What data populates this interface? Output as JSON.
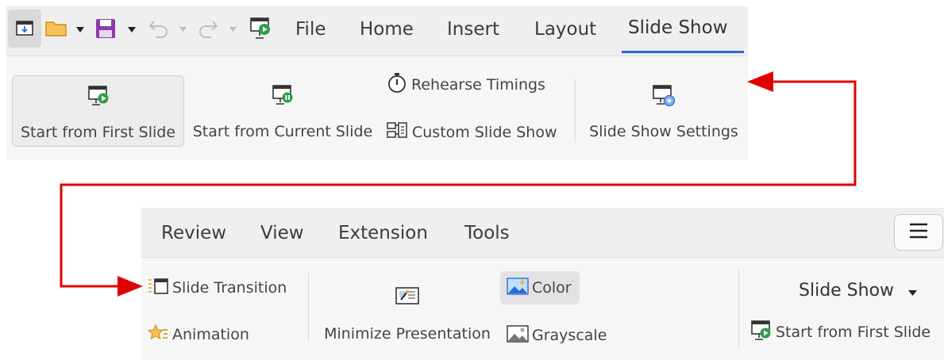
{
  "toolbar1": {
    "quick_access": [
      "slide-icon",
      "open-folder-icon",
      "save-icon",
      "undo-icon",
      "redo-icon",
      "play-slideshow-icon"
    ],
    "tabs": [
      "File",
      "Home",
      "Insert",
      "Layout",
      "Slide Show"
    ],
    "active_tab": "Slide Show",
    "start_first": "Start from First Slide",
    "start_current": "Start from Current Slide",
    "rehearse": "Rehearse Timings",
    "custom_show": "Custom Slide Show",
    "settings": "Slide Show Settings"
  },
  "toolbar2": {
    "tabs": [
      "Review",
      "View",
      "Extension",
      "Tools"
    ],
    "menu_icon": "hamburger-icon",
    "slide_transition": "Slide Transition",
    "animation": "Animation",
    "minimize": "Minimize Presentation",
    "color": "Color",
    "grayscale": "Grayscale",
    "section_title": "Slide Show",
    "start_first": "Start from First Slide"
  },
  "colors": {
    "accent_underline": "#2a6ad8",
    "arrow": "#e00000",
    "icon_green": "#2e9e4a",
    "save_purple": "#8e3aa8",
    "folder_orange": "#f0a020"
  }
}
